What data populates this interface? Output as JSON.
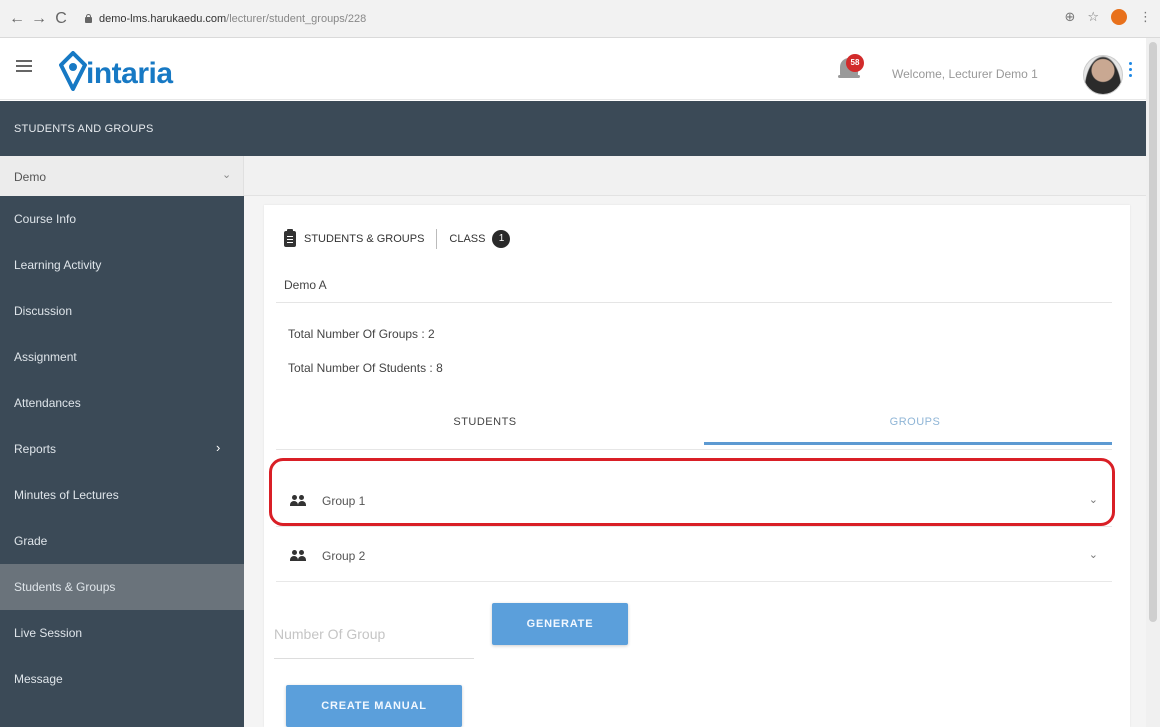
{
  "browser": {
    "nav_back": "←",
    "nav_forward": "→",
    "nav_reload": "C",
    "url_host": "demo-lms.harukaedu.com",
    "url_path": "/lecturer/student_groups/228",
    "zoom_icon": "⊕",
    "star_icon": "☆",
    "menu_icon": "⋮"
  },
  "header": {
    "logo_text": "intaria",
    "notification_count": "58",
    "welcome_text": "Welcome, Lecturer Demo 1"
  },
  "titlebar": {
    "title": "STUDENTS AND GROUPS"
  },
  "course_select": {
    "value": "Demo",
    "chevron": "⌄"
  },
  "sidebar": {
    "items": [
      {
        "label": "Course Info"
      },
      {
        "label": "Learning Activity"
      },
      {
        "label": "Discussion"
      },
      {
        "label": "Assignment"
      },
      {
        "label": "Attendances"
      },
      {
        "label": "Reports",
        "arrow": "›"
      },
      {
        "label": "Minutes of Lectures"
      },
      {
        "label": "Grade"
      },
      {
        "label": "Students & Groups"
      },
      {
        "label": "Live Session"
      },
      {
        "label": "Message"
      }
    ]
  },
  "main": {
    "section_label": "STUDENTS & GROUPS",
    "class_label": "CLASS",
    "class_count": "1",
    "course_name": "Demo A",
    "total_groups": "Total Number Of Groups : 2",
    "total_students": "Total Number Of Students : 8",
    "tabs": [
      {
        "label": "STUDENTS"
      },
      {
        "label": "GROUPS"
      }
    ],
    "groups": [
      {
        "label": "Group 1"
      },
      {
        "label": "Group 2"
      }
    ],
    "group_chevron": "⌄",
    "number_of_group_placeholder": "Number Of Group",
    "generate_label": "GENERATE",
    "create_manual_label": "CREATE MANUAL"
  },
  "colors": {
    "sidebar_bg": "#3b4a57",
    "accent": "#5b9fdb",
    "highlight": "#d91f26",
    "logo": "#1779c4"
  }
}
